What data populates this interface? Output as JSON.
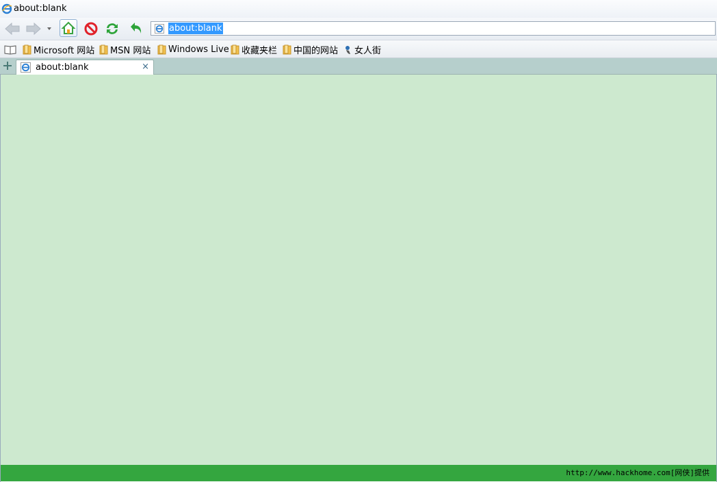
{
  "window": {
    "title": "about:blank"
  },
  "toolbar": {
    "back_icon": "back-arrow-icon",
    "forward_icon": "forward-arrow-icon",
    "home_icon": "home-icon",
    "stop_icon": "stop-icon",
    "refresh_icon": "refresh-icon",
    "undo_icon": "undo-arrow-icon"
  },
  "address_bar": {
    "value": "about:blank"
  },
  "favorites_bar": {
    "items": [
      {
        "label": "Microsoft 网站",
        "icon": "folder-icon"
      },
      {
        "label": "MSN 网站",
        "icon": "folder-icon"
      },
      {
        "label": "Windows Live",
        "icon": "folder-icon"
      },
      {
        "label": "收藏夹栏",
        "icon": "folder-icon"
      },
      {
        "label": "中国的网站",
        "icon": "folder-icon"
      },
      {
        "label": "女人街",
        "icon": "link-icon"
      }
    ]
  },
  "tabs": [
    {
      "label": "about:blank",
      "close": "×"
    }
  ],
  "status_bar": {
    "text": "http://www.hackhome.com[网侠]提供"
  },
  "colors": {
    "content_bg": "#cde9cf",
    "tabbar_bg": "#b6cfcc",
    "status_bg": "#34a63f",
    "selection": "#3399ff"
  }
}
